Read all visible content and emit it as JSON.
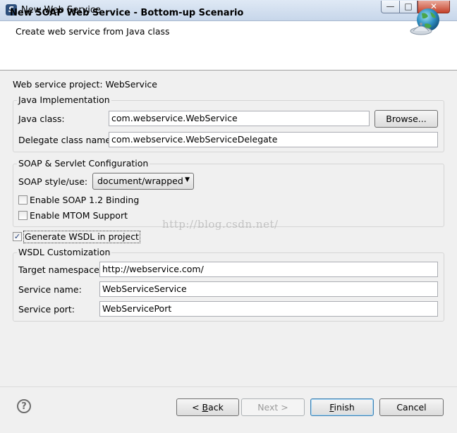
{
  "window": {
    "title": "New Web Service",
    "app_icon_glyph": "S",
    "minimize_glyph": "—",
    "maximize_glyph": "□",
    "close_glyph": "✕"
  },
  "header": {
    "title": "New SOAP Web Service - Bottom-up Scenario",
    "description": "Create web service from Java class",
    "icon": "web-service-globe-icon"
  },
  "project_line": "Web service project: WebService",
  "java_impl": {
    "legend": "Java Implementation",
    "java_class_label": "Java class:",
    "java_class_value": "com.webservice.WebService",
    "browse_label": "Browse...",
    "delegate_label": "Delegate class name:",
    "delegate_value": "com.webservice.WebServiceDelegate"
  },
  "soap_config": {
    "legend": "SOAP & Servlet Configuration",
    "style_label": "SOAP style/use:",
    "style_value": "document/wrapped",
    "soap12_label": "Enable SOAP 1.2 Binding",
    "soap12_checked": false,
    "mtom_label": "Enable MTOM Support",
    "mtom_checked": false
  },
  "generate_wsdl": {
    "label": "Generate WSDL in project",
    "checked": true
  },
  "wsdl_custom": {
    "legend": "WSDL Customization",
    "namespace_label": "Target namespace:",
    "namespace_value": "http://webservice.com/",
    "service_name_label": "Service name:",
    "service_name_value": "WebServiceService",
    "service_port_label": "Service port:",
    "service_port_value": "WebServicePort"
  },
  "watermark": "http://blog.csdn.net/",
  "footer": {
    "help_glyph": "?",
    "back_prefix": "< ",
    "back_mnemonic": "B",
    "back_rest": "ack",
    "next_label": "Next >",
    "finish_mnemonic": "F",
    "finish_rest": "inish",
    "cancel_label": "Cancel"
  },
  "colors": {
    "accent": "#3c7fb1",
    "background": "#f0f0f0",
    "header_bg": "#ffffff"
  }
}
